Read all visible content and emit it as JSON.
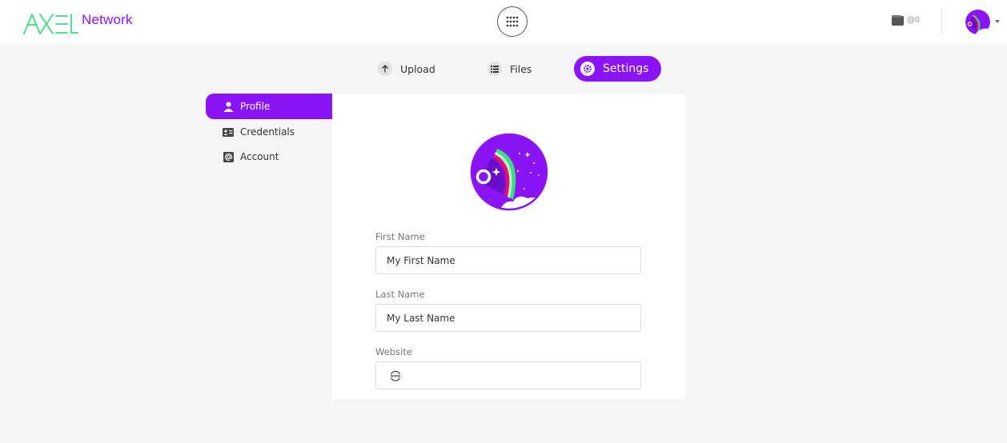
{
  "header": {
    "logo_text": "Network",
    "wallet_amount": "@0"
  },
  "tabs": [
    {
      "label": "Upload",
      "icon": "arrow-up-icon",
      "active": false
    },
    {
      "label": "Files",
      "icon": "list-icon",
      "active": false
    },
    {
      "label": "Settings",
      "icon": "gear-icon",
      "active": true
    }
  ],
  "sidebar": {
    "items": [
      {
        "label": "Profile",
        "icon": "user-icon",
        "active": true
      },
      {
        "label": "Credentials",
        "icon": "id-card-icon",
        "active": false
      },
      {
        "label": "Account",
        "icon": "at-icon",
        "active": false
      }
    ]
  },
  "form": {
    "first_name_label": "First Name",
    "first_name_value": "My First Name",
    "last_name_label": "Last Name",
    "last_name_value": "My Last Name",
    "website_label": "Website",
    "website_value": ""
  },
  "colors": {
    "accent": "#8a14f5",
    "logo_green": "#3ddc84"
  }
}
